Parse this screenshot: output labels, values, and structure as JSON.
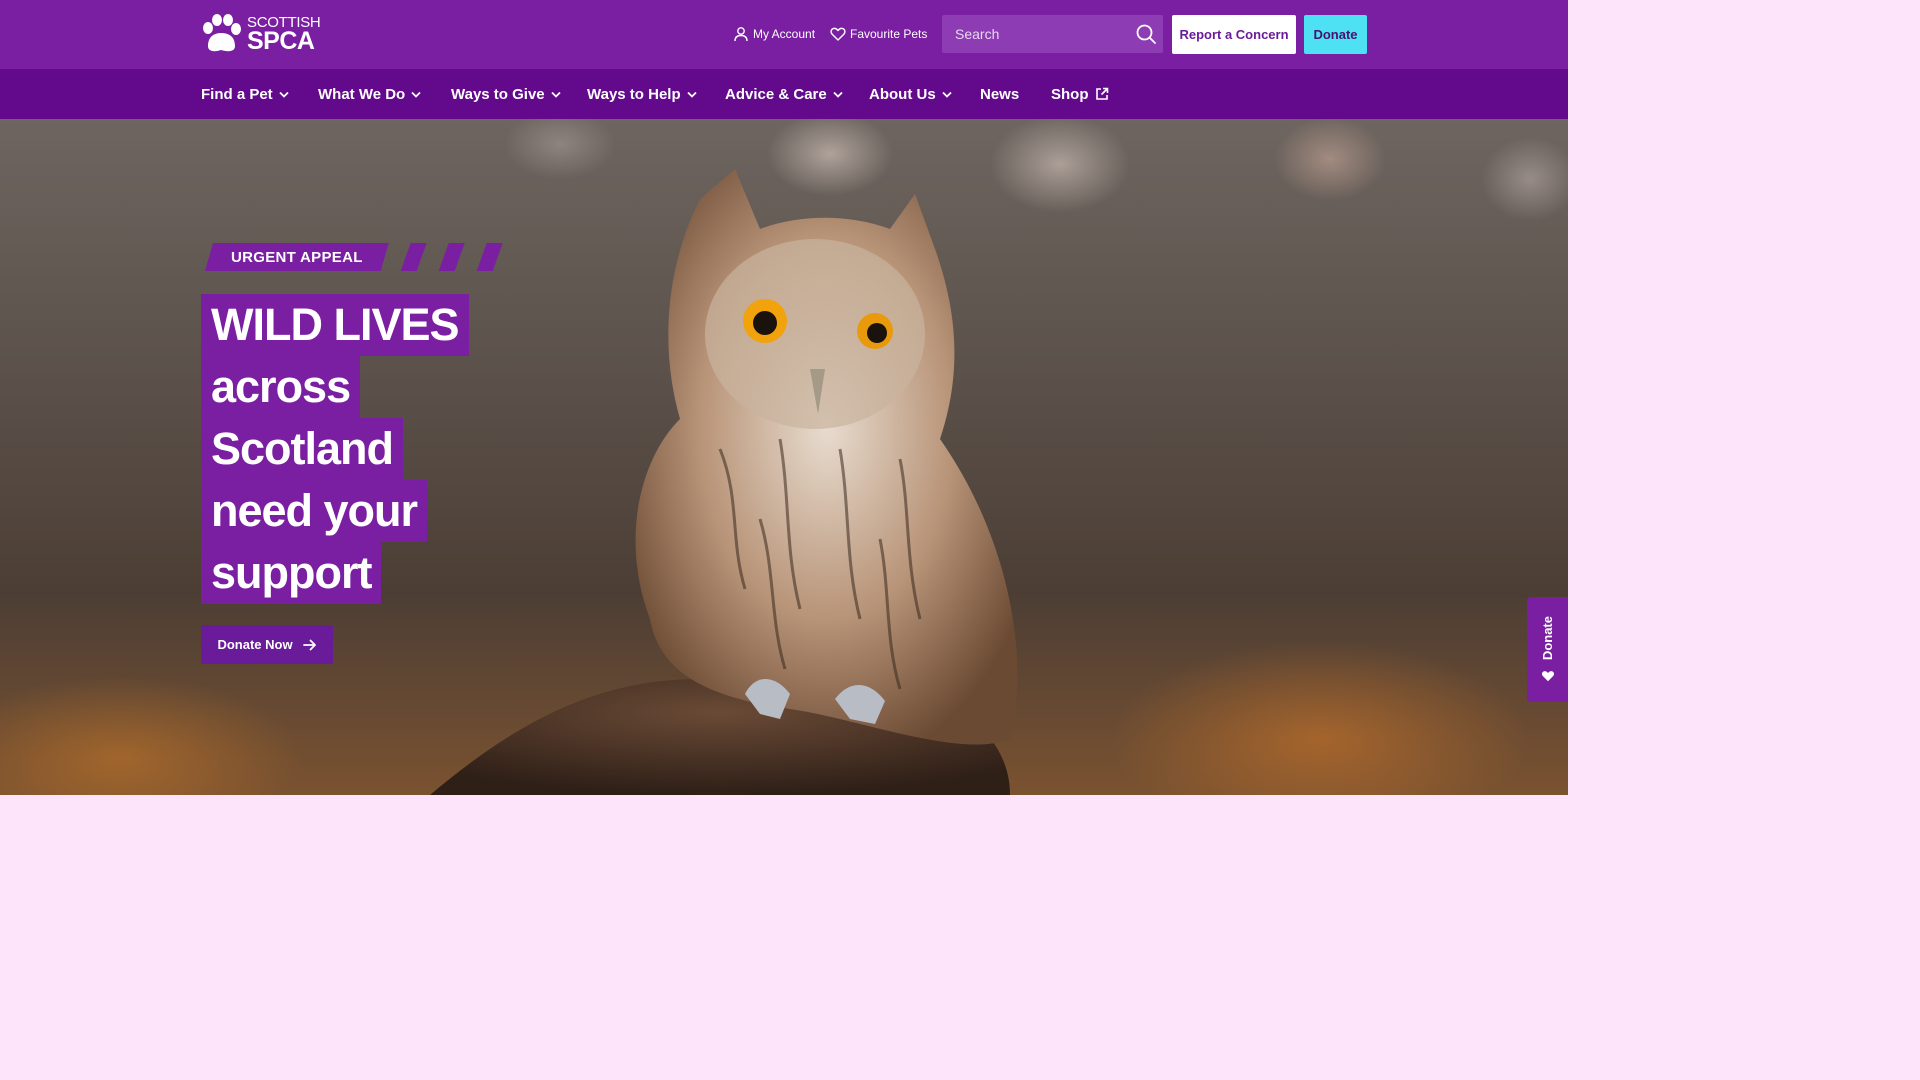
{
  "brand": {
    "line1": "SCOTTISH",
    "line2": "SPCA"
  },
  "utility": {
    "account_label": "My Account",
    "favourites_label": "Favourite Pets",
    "search_placeholder": "Search",
    "report_label": "Report a Concern",
    "donate_label": "Donate"
  },
  "nav": {
    "items": [
      {
        "label": "Find a Pet"
      },
      {
        "label": "What We Do"
      },
      {
        "label": "Ways to Give"
      },
      {
        "label": "Ways to Help"
      },
      {
        "label": "Advice & Care"
      },
      {
        "label": "About Us"
      },
      {
        "label": "News"
      },
      {
        "label": "Shop"
      }
    ]
  },
  "hero": {
    "tag": "URGENT APPEAL",
    "headline": [
      "WILD LIVES",
      "across",
      "Scotland",
      "need your",
      "support"
    ],
    "cta_label": "Donate Now"
  },
  "side_tab": {
    "label": "Donate"
  },
  "colors": {
    "brand_purple": "#7a1fa2",
    "nav_purple": "#630a8c",
    "accent_cyan": "#4de1f3",
    "page_background": "#fde4fb"
  }
}
